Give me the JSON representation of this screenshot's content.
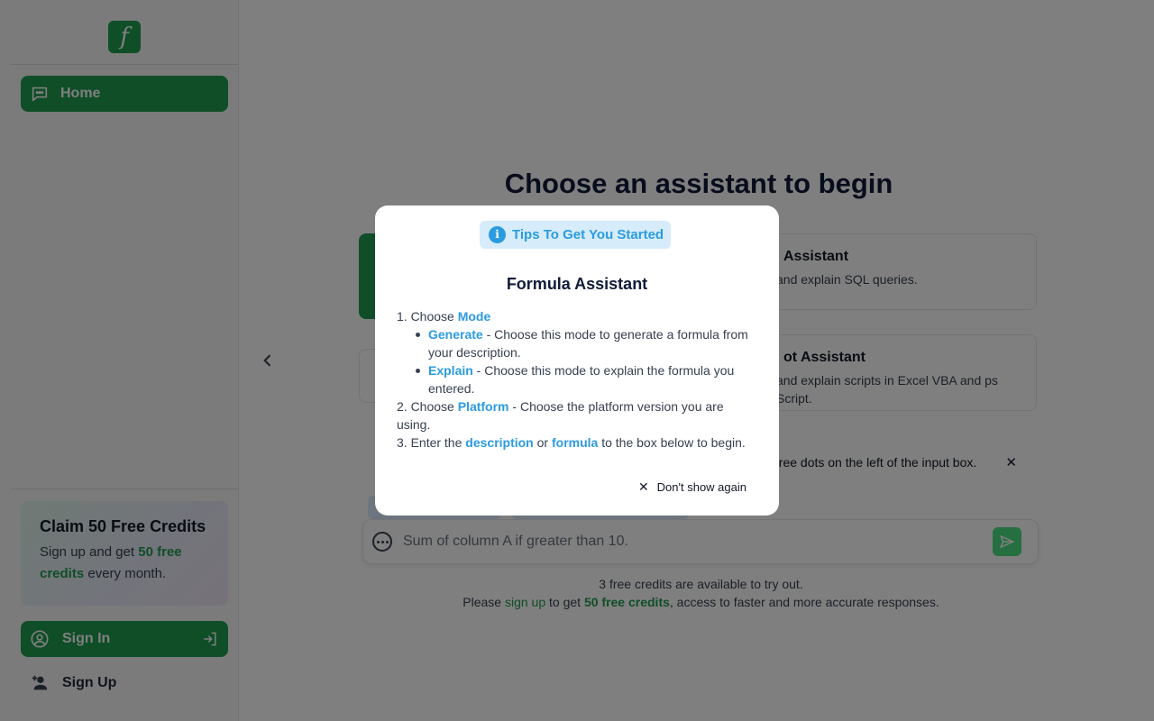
{
  "sidebar": {
    "logo_letter": "f",
    "home_label": "Home",
    "promo": {
      "title": "Claim 50 Free Credits",
      "text_before": "Sign up and get ",
      "text_highlight": "50 free credits",
      "text_after": " every month."
    },
    "signin_label": "Sign In",
    "signup_label": "Sign Up"
  },
  "main": {
    "title": "Choose an assistant to begin",
    "cards": {
      "sql_title": "Assistant",
      "sql_desc": "and explain SQL queries.",
      "script_title": "ot Assistant",
      "script_desc": "and explain scripts in Excel VBA and ps Script."
    },
    "notice_text": "hree dots on the left of the input box.",
    "input_placeholder": "Sum of column A if greater than 10.",
    "credits_line1": "3 free credits are available to try out.",
    "credits_line2_before": "Please ",
    "credits_signup_link": "sign up",
    "credits_line2_mid": " to get ",
    "credits_free": "50 free credits",
    "credits_line2_after": ", access to faster and more accurate responses."
  },
  "modal": {
    "badge": "Tips To Get You Started",
    "title": "Formula Assistant",
    "step1_prefix": "1. Choose ",
    "step1_kw": "Mode",
    "generate_kw": "Generate",
    "generate_text": " - Choose this mode to generate a formula from your description.",
    "explain_kw": "Explain",
    "explain_text": " - Choose this mode to explain the formula you entered.",
    "step2_prefix": "2. Choose ",
    "step2_kw": "Platform",
    "step2_text": " - Choose the platform version you are using.",
    "step3_prefix": "3. Enter the ",
    "step3_kw1": "description",
    "step3_mid": " or ",
    "step3_kw2": "formula",
    "step3_text": " to the box below to begin.",
    "dont_show": "Don't show again"
  },
  "colors": {
    "brand_green": "#1f9d4f",
    "accent_blue": "#2b9be0"
  }
}
